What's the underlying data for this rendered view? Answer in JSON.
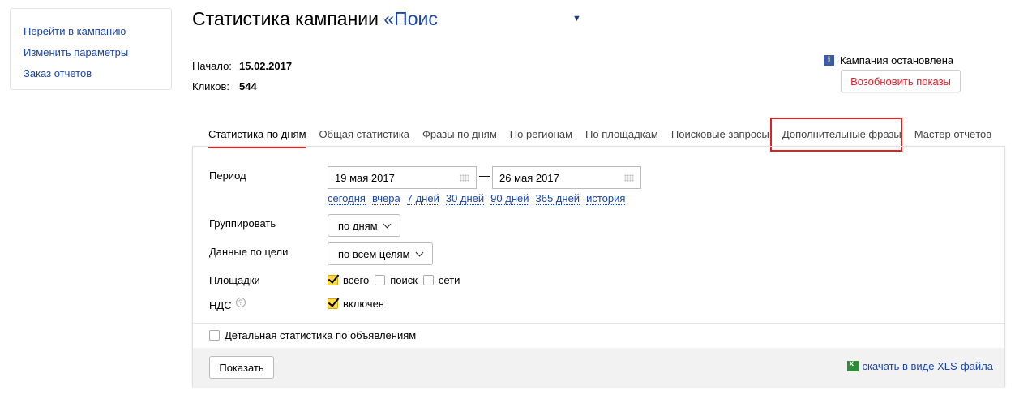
{
  "sidebar": {
    "items": [
      "Перейти в кампанию",
      "Изменить параметры",
      "Заказ отчетов"
    ]
  },
  "header": {
    "title_prefix": "Статистика кампании ",
    "title_campaign": "«Поис",
    "start_label": "Начало:",
    "start_value": "15.02.2017",
    "clicks_label": "Кликов:",
    "clicks_value": "544",
    "status_text": "Кампания остановлена",
    "resume_label": "Возобновить показы"
  },
  "tabs": [
    "Статистика по дням",
    "Общая статистика",
    "Фразы по дням",
    "По регионам",
    "По площадкам",
    "Поисковые запросы",
    "Дополнительные фразы",
    "Мастер отчётов"
  ],
  "form": {
    "period_label": "Период",
    "date_from": "19 мая 2017",
    "date_to": "26 мая 2017",
    "date_dash": "—",
    "quick": [
      "сегодня",
      "вчера",
      "7 дней",
      "30 дней",
      "90 дней",
      "365 дней",
      "история"
    ],
    "group_label": "Группировать",
    "group_value": "по дням",
    "goal_label": "Данные по цели",
    "goal_value": "по всем целям",
    "platforms_label": "Площадки",
    "platform_all": "всего",
    "platform_search": "поиск",
    "platform_net": "сети",
    "vat_label": "НДС",
    "vat_value": "включен",
    "detail_label": "Детальная статистика по объявлениям",
    "show_label": "Показать",
    "xls_label": "скачать в виде XLS-файла"
  },
  "colors": {
    "link": "#1a46a8",
    "accent_red": "#e02020",
    "check_yellow": "#ffdb4d"
  }
}
